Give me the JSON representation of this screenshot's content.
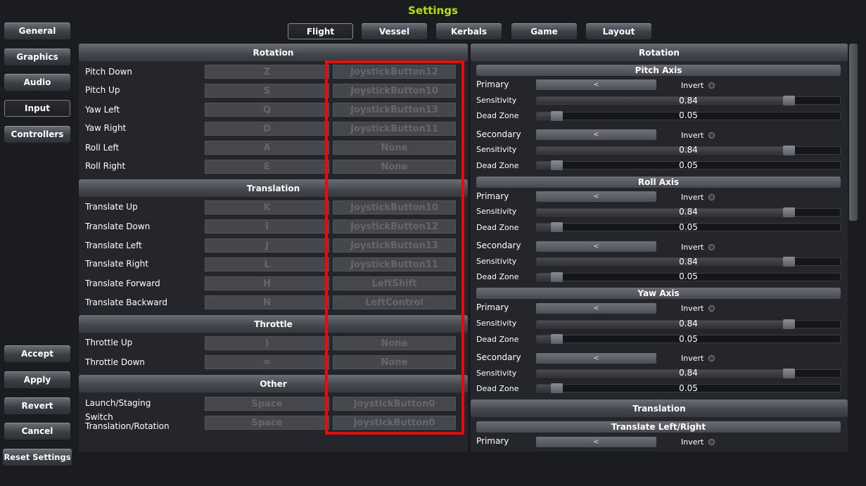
{
  "title": "Settings",
  "sidebar": {
    "top": [
      "General",
      "Graphics",
      "Audio",
      "Input",
      "Controllers"
    ],
    "active": "Input",
    "bottom": [
      "Accept",
      "Apply",
      "Revert",
      "Cancel",
      "Reset Settings"
    ]
  },
  "tabs": [
    "Flight",
    "Vessel",
    "Kerbals",
    "Game",
    "Layout"
  ],
  "active_tab": "Flight",
  "left": {
    "sections": [
      {
        "title": "Rotation",
        "rows": [
          {
            "label": "Pitch Down",
            "key": "Z",
            "alt": "JoystickButton12"
          },
          {
            "label": "Pitch Up",
            "key": "S",
            "alt": "JoystickButton10"
          },
          {
            "label": "Yaw Left",
            "key": "Q",
            "alt": "JoystickButton13"
          },
          {
            "label": "Yaw Right",
            "key": "D",
            "alt": "JoystickButton11"
          },
          {
            "label": "Roll Left",
            "key": "A",
            "alt": "None"
          },
          {
            "label": "Roll Right",
            "key": "E",
            "alt": "None"
          }
        ]
      },
      {
        "title": "Translation",
        "rows": [
          {
            "label": "Translate Up",
            "key": "K",
            "alt": "JoystickButton10"
          },
          {
            "label": "Translate Down",
            "key": "I",
            "alt": "JoystickButton12"
          },
          {
            "label": "Translate Left",
            "key": "J",
            "alt": "JoystickButton13"
          },
          {
            "label": "Translate Right",
            "key": "L",
            "alt": "JoystickButton11"
          },
          {
            "label": "Translate Forward",
            "key": "H",
            "alt": "LeftShift"
          },
          {
            "label": "Translate Backward",
            "key": "N",
            "alt": "LeftControl"
          }
        ]
      },
      {
        "title": "Throttle",
        "rows": [
          {
            "label": "Throttle Up",
            "key": ")",
            "alt": "None"
          },
          {
            "label": "Throttle Down",
            "key": "=",
            "alt": "None"
          }
        ]
      },
      {
        "title": "Other",
        "rows": [
          {
            "label": "Launch/Staging",
            "key": "Space",
            "alt": "JoystickButton0"
          },
          {
            "label": "Switch\nTranslation/Rotation",
            "key": "Space",
            "alt": "JoystickButton0"
          }
        ]
      }
    ]
  },
  "right": {
    "header": "Rotation",
    "axes": [
      {
        "title": "Pitch Axis",
        "groups": [
          {
            "label": "Primary",
            "dropdown": "<",
            "invert": "Invert",
            "sensitivity_label": "Sensitivity",
            "sensitivity": "0.84",
            "deadzone_label": "Dead Zone",
            "deadzone": "0.05"
          },
          {
            "label": "Secondary",
            "dropdown": "<",
            "invert": "Invert",
            "sensitivity_label": "Sensitivity",
            "sensitivity": "0.84",
            "deadzone_label": "Dead Zone",
            "deadzone": "0.05"
          }
        ]
      },
      {
        "title": "Roll Axis",
        "groups": [
          {
            "label": "Primary",
            "dropdown": "<",
            "invert": "Invert",
            "sensitivity_label": "Sensitivity",
            "sensitivity": "0.84",
            "deadzone_label": "Dead Zone",
            "deadzone": "0.05"
          },
          {
            "label": "Secondary",
            "dropdown": "<",
            "invert": "Invert",
            "sensitivity_label": "Sensitivity",
            "sensitivity": "0.84",
            "deadzone_label": "Dead Zone",
            "deadzone": "0.05"
          }
        ]
      },
      {
        "title": "Yaw Axis",
        "groups": [
          {
            "label": "Primary",
            "dropdown": "<",
            "invert": "Invert",
            "sensitivity_label": "Sensitivity",
            "sensitivity": "0.84",
            "deadzone_label": "Dead Zone",
            "deadzone": "0.05"
          },
          {
            "label": "Secondary",
            "dropdown": "<",
            "invert": "Invert",
            "sensitivity_label": "Sensitivity",
            "sensitivity": "0.84",
            "deadzone_label": "Dead Zone",
            "deadzone": "0.05"
          }
        ]
      }
    ],
    "translation_header": "Translation",
    "translation_axis": {
      "title": "Translate Left/Right",
      "label": "Primary",
      "dropdown": "<",
      "invert": "Invert"
    }
  }
}
